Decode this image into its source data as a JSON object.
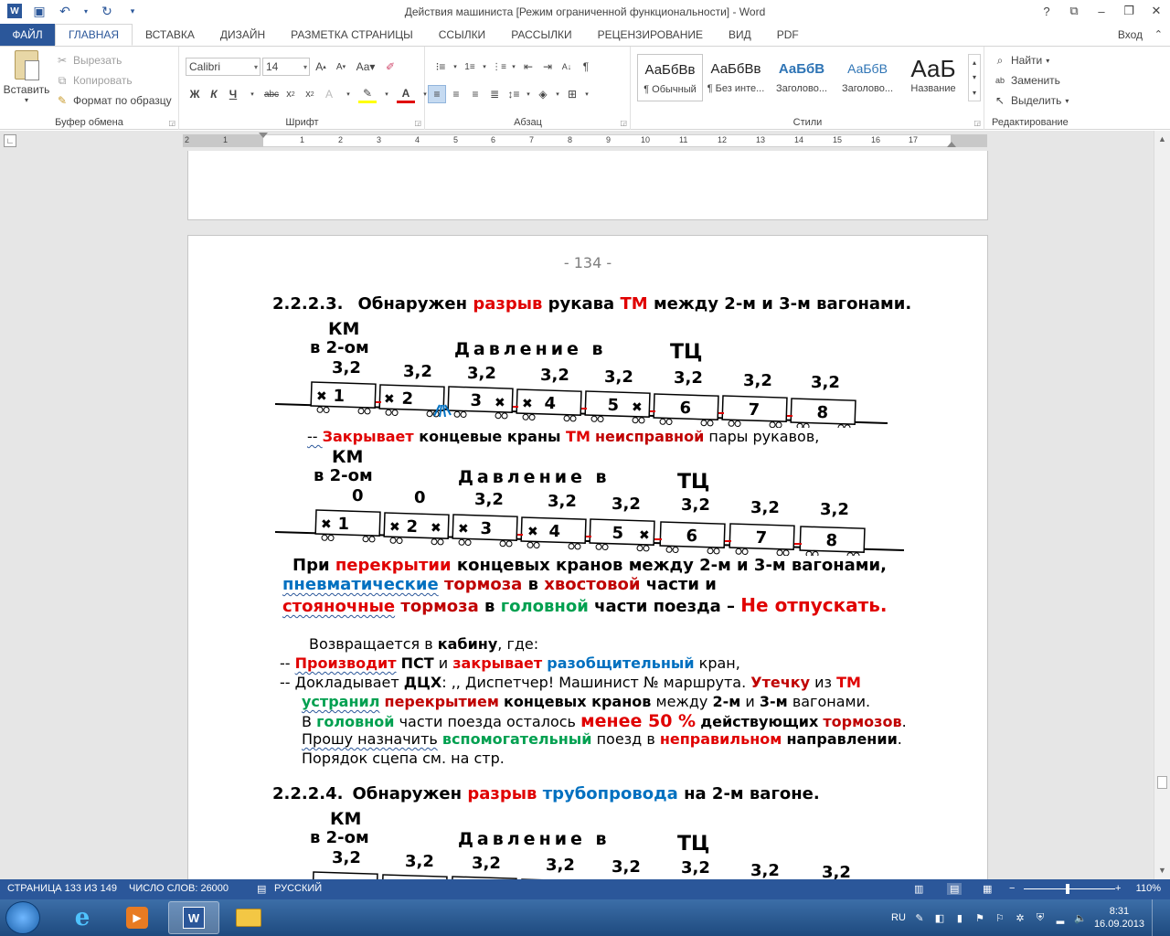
{
  "window": {
    "title": "Действия   машиниста [Режим ограниченной функциональности] - Word",
    "help": "?",
    "controls": [
      "⧉",
      "–",
      "❐",
      "✕"
    ]
  },
  "tabs": [
    "ФАЙЛ",
    "ГЛАВНАЯ",
    "ВСТАВКА",
    "ДИЗАЙН",
    "РАЗМЕТКА СТРАНИЦЫ",
    "ССЫЛКИ",
    "РАССЫЛКИ",
    "РЕЦЕНЗИРОВАНИЕ",
    "ВИД",
    "PDF"
  ],
  "login": "Вход",
  "ribbon": {
    "clipboard": {
      "label": "Буфер обмена",
      "paste": "Вставить",
      "cut": "Вырезать",
      "copy": "Копировать",
      "format_painter": "Формат по образцу"
    },
    "font": {
      "label": "Шрифт",
      "name": "Calibri",
      "size": "14",
      "aa": "Аа"
    },
    "paragraph": {
      "label": "Абзац"
    },
    "styles": {
      "label": "Стили",
      "items": [
        {
          "sample": "АаБбВв",
          "name": "¶ Обычный"
        },
        {
          "sample": "АаБбВв",
          "name": "¶ Без инте..."
        },
        {
          "sample": "АаБбВ",
          "name": "Заголово..."
        },
        {
          "sample": "АаБбВ",
          "name": "Заголово..."
        },
        {
          "sample": "АаБ",
          "name": "Название"
        }
      ]
    },
    "editing": {
      "label": "Редактирование",
      "find": "Найти",
      "replace": "Заменить",
      "select": "Выделить"
    }
  },
  "ruler": {
    "numbers": [
      "2",
      "1",
      "1",
      "2",
      "3",
      "4",
      "5",
      "6",
      "7",
      "8",
      "9",
      "10",
      "11",
      "12",
      "13",
      "14",
      "15",
      "16",
      "17"
    ]
  },
  "document": {
    "page_number": "- 134 -",
    "heading1": {
      "num": "2.2.2.3.",
      "t1": "Обнаружен ",
      "t2": "разрыв",
      "t3": " рукава ",
      "t4": "ТМ",
      "t5": " между 2-м и 3-м вагонами."
    },
    "diagram_labels": {
      "km": "КМ",
      "v2": "в 2-ом",
      "pressure": "Давление  в",
      "tc": "ТЦ"
    },
    "diagram1": {
      "values": [
        "3,2",
        "3,2",
        "3,2",
        "3,2",
        "3,2",
        "3,2",
        "3,2",
        "3,2"
      ],
      "cars": [
        "1",
        "2",
        "3",
        "4",
        "5",
        "6",
        "7",
        "8"
      ]
    },
    "line_close": {
      "dash": "-- ",
      "t1": "Закрывает",
      "t2": " концевые краны ",
      "t3": "ТМ",
      "t4": "  ",
      "t5": "неисправной",
      "t6": " пары рукавов,"
    },
    "diagram2": {
      "values": [
        "0",
        "0",
        "3,2",
        "3,2",
        "3,2",
        "3,2",
        "3,2",
        "3,2"
      ],
      "cars": [
        "1",
        "2",
        "3",
        "4",
        "5",
        "6",
        "7",
        "8"
      ]
    },
    "para1": {
      "l1a": "При ",
      "l1b": "перекрытии",
      "l1c": " концевых кранов между 2-м и 3-м вагонами,",
      "l2a": "пневматические",
      "l2b": " ",
      "l2c": "тормоза",
      "l2d": " в ",
      "l2e": "хвостовой",
      "l2f": " части и",
      "l3a": "стояночные",
      "l3b": " ",
      "l3c": "тормоза",
      "l3d": " в ",
      "l3e": "головной",
      "l3f": " части поезда  –  ",
      "l3g": "Не отпускать."
    },
    "para2": {
      "l1a": "Возвращается в ",
      "l1b": "кабину",
      "l1c": ", где:",
      "l2a": "--  ",
      "l2b": "Производит",
      "l2c": " ",
      "l2d": "ПСТ",
      "l2e": " и ",
      "l2f": "закрывает",
      "l2g": " ",
      "l2h": "разобщительный",
      "l2i": " кран,",
      "l3a": "--  Докладывает ",
      "l3b": "ДЦХ",
      "l3c": ": ,, Диспетчер! Машинист № маршрута. ",
      "l3d": "Утечку",
      "l3e": " из ",
      "l3f": "ТМ",
      "l4a": "устранил",
      "l4b": " ",
      "l4c": "перекрытием",
      "l4d": " ",
      "l4e": "концевых кранов",
      "l4f": "  между ",
      "l4g": "2-м",
      "l4h": " и ",
      "l4i": "3-м",
      "l4j": " вагонами.",
      "l5a": "В ",
      "l5b": "головной",
      "l5c": " части поезда осталось ",
      "l5d": "менее 50 %",
      "l5e": " ",
      "l5f": "действующих",
      "l5g": " ",
      "l5h": "тормозов",
      "l5i": ".",
      "l6a": "Прошу  назначить",
      "l6b": " ",
      "l6c": "вспомогательный",
      "l6d": " поезд в ",
      "l6e": "неправильном",
      "l6f": " ",
      "l6g": "направлении",
      "l6h": ".",
      "l7": "Порядок сцепа см. на стр."
    },
    "heading2": {
      "num": "2.2.2.4.",
      "t1": "Обнаружен ",
      "t2": "разрыв",
      "t3": " ",
      "t4": "трубопровода",
      "t5": " на 2-м вагоне."
    },
    "diagram3": {
      "values": [
        "3,2",
        "3,2",
        "3,2",
        "3,2",
        "3,2",
        "3,2",
        "3,2",
        "3,2"
      ]
    }
  },
  "status": {
    "page": "СТРАНИЦА 133 ИЗ 149",
    "words": "ЧИСЛО СЛОВ: 26000",
    "lang": "РУССКИЙ",
    "zoom": "110%",
    "minus": "−",
    "plus": "+"
  },
  "taskbar": {
    "lang": "RU",
    "time": "8:31",
    "date": "16.09.2013"
  },
  "colors": {
    "accent": "#2b579a",
    "red": "#e00000",
    "blue": "#0070c0",
    "green": "#00a050"
  }
}
